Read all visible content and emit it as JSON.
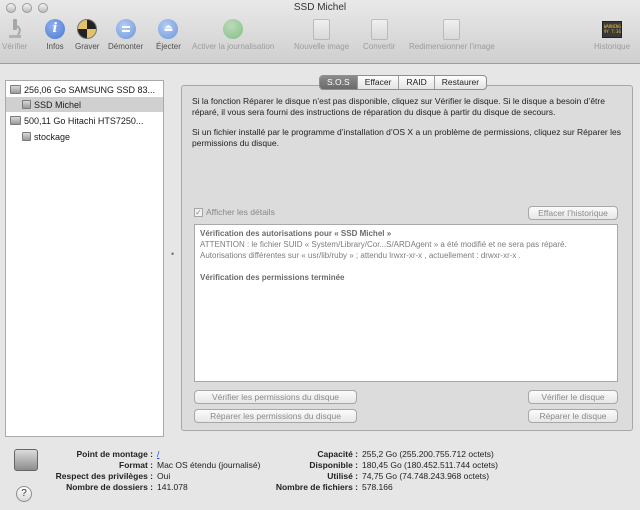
{
  "window": {
    "title": "SSD Michel"
  },
  "toolbar": {
    "verify": "Vérifier",
    "info": "Infos",
    "burn": "Graver",
    "unmount": "Démonter",
    "eject": "Éjecter",
    "enable_journaling": "Activer la journalisation",
    "new_image": "Nouvelle image",
    "convert": "Convertir",
    "resize_image": "Redimensionner l’image",
    "log": "Historique",
    "log_icon_text": "WARNING\n9Y 7:36"
  },
  "sidebar": {
    "items": [
      {
        "label": "256,06 Go SAMSUNG SSD 83..."
      },
      {
        "label": "SSD Michel"
      },
      {
        "label": "500,11 Go Hitachi HTS7250..."
      },
      {
        "label": "stockage"
      }
    ]
  },
  "tabs": [
    {
      "label": "S.O.S"
    },
    {
      "label": "Effacer"
    },
    {
      "label": "RAID"
    },
    {
      "label": "Restaurer"
    }
  ],
  "first_aid": {
    "info_1": "Si la fonction Réparer le disque n’est pas disponible, cliquez sur Vérifier le disque. Si le disque a besoin d’être réparé, il vous sera fourni des instructions de réparation du disque à partir du disque de secours.",
    "info_2": "Si un fichier installé par le programme d’installation d’OS X a un problème de permissions, cliquez sur Réparer les permissions du disque.",
    "show_details_label": "Afficher les détails",
    "show_details_checked": true,
    "clear_history_button": "Effacer l’historique",
    "log": {
      "line1": "Vérification des autorisations pour « SSD Michel »",
      "line2": "ATTENTION : le fichier SUID « System/Library/Cor...S/ARDAgent » a été modifié et ne sera pas réparé.",
      "line3": "Autorisations différentes sur « usr/lib/ruby » ; attendu lrwxr-xr-x , actuellement : drwxr-xr-x .",
      "line4": "Vérification des permissions terminée"
    },
    "verify_permissions_button": "Vérifier les permissions du disque",
    "repair_permissions_button": "Réparer les permissions du disque",
    "verify_disk_button": "Vérifier le disque",
    "repair_disk_button": "Réparer le disque",
    "split_handle": "•"
  },
  "disk_info": {
    "mount_point_label": "Point de montage :",
    "mount_point_value": "/",
    "format_label": "Format :",
    "format_value": "Mac OS étendu (journalisé)",
    "ownership_label": "Respect des privilèges :",
    "ownership_value": "Oui",
    "folders_label": "Nombre de dossiers :",
    "folders_value": "141.078",
    "capacity_label": "Capacité :",
    "capacity_value": "255,2 Go (255.200.755.712 octets)",
    "available_label": "Disponible :",
    "available_value": "180,45 Go (180.452.511.744 octets)",
    "used_label": "Utilisé :",
    "used_value": "74,75 Go (74.748.243.968 octets)",
    "files_label": "Nombre de fichiers :",
    "files_value": "578.166",
    "help_glyph": "?"
  },
  "colors": {
    "accent_blue": "#1a4bd2",
    "journaling_green": "#3ca63c",
    "info_icon_blue": "#4b77d1"
  }
}
